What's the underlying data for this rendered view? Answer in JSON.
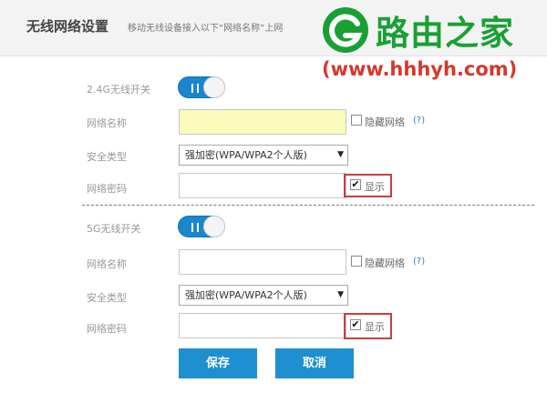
{
  "header": {
    "title": "无线网络设置",
    "subtitle": "移动无线设备接入以下“网络名称”上网"
  },
  "watermark": {
    "text": "路由之家",
    "url": "(www.hhhyh.com)",
    "color": "#19a034",
    "url_color": "#d7372c"
  },
  "band24": {
    "switch_label": "2.4G无线开关",
    "switch_on": true,
    "ssid_label": "网络名称",
    "ssid_value": "",
    "hide_label": "隐藏网络",
    "hide_checked": false,
    "help": "(?)",
    "security_label": "安全类型",
    "security_value": "强加密(WPA/WPA2个人版)",
    "password_label": "网络密码",
    "password_value": "",
    "show_label": "显示",
    "show_checked": true
  },
  "band5": {
    "switch_label": "5G无线开关",
    "switch_on": true,
    "ssid_label": "网络名称",
    "ssid_value": "",
    "hide_label": "隐藏网络",
    "hide_checked": false,
    "help": "(?)",
    "security_label": "安全类型",
    "security_value": "强加密(WPA/WPA2个人版)",
    "password_label": "网络密码",
    "password_value": "",
    "show_label": "显示",
    "show_checked": true
  },
  "actions": {
    "save": "保存",
    "cancel": "取消"
  },
  "colors": {
    "accent": "#1e8fd0",
    "toggle_on": "#1a86cc",
    "highlight_box": "#c63f3f",
    "ssid_fill": "#fbfbbd"
  },
  "icons": {
    "checkmark": "✔",
    "dropdown": "▼"
  }
}
